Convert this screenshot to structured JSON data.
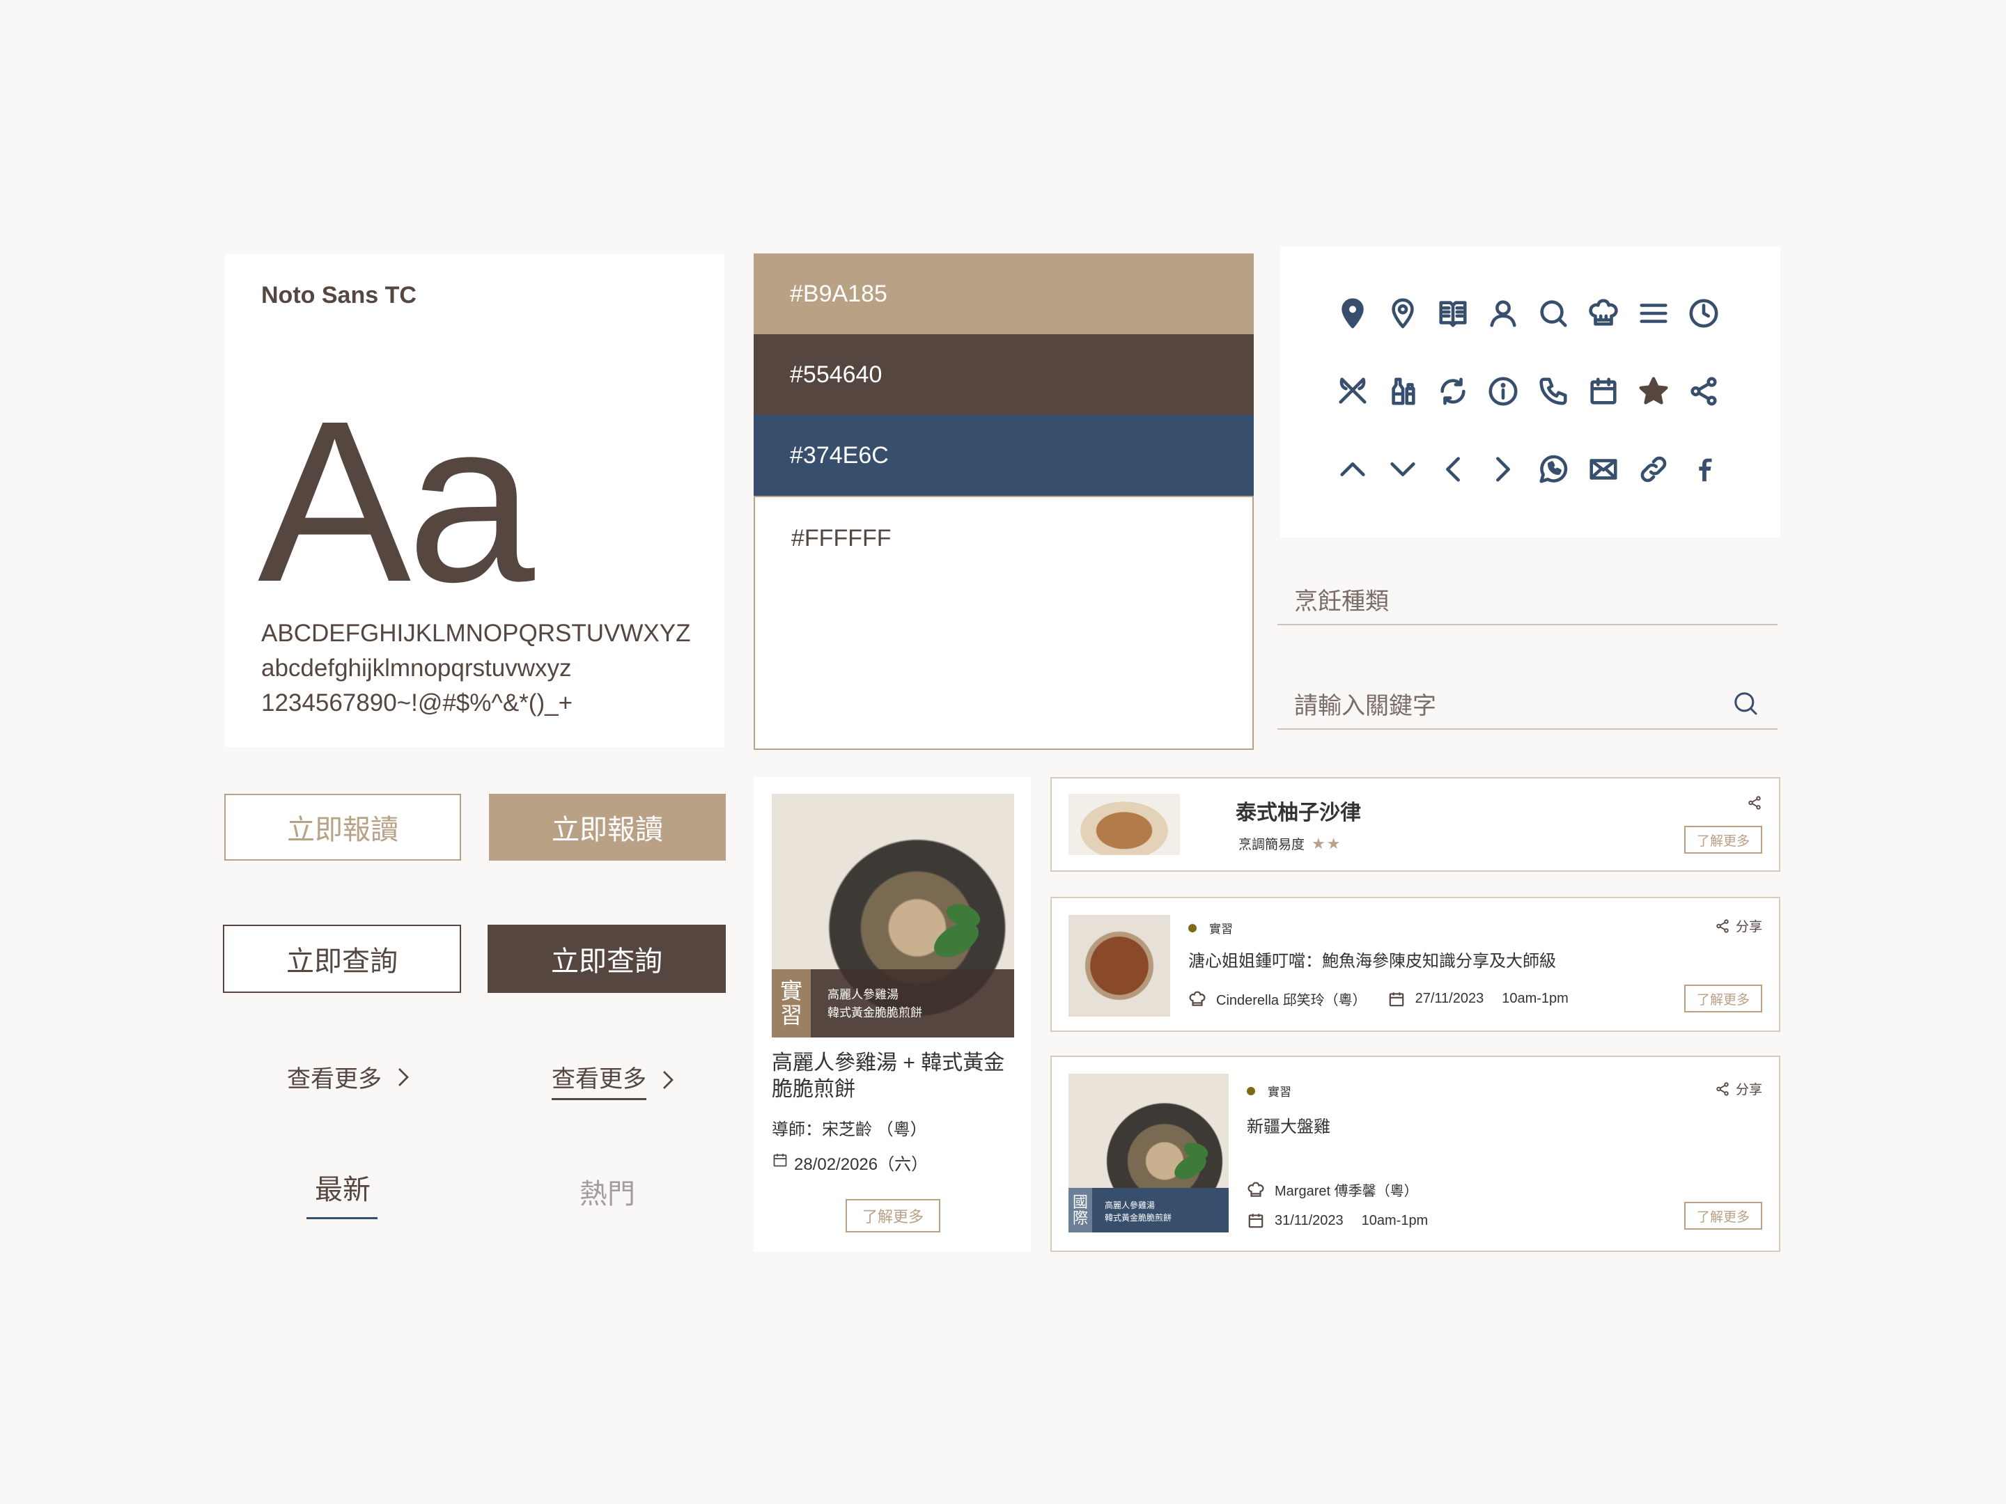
{
  "typography": {
    "font_name": "Noto Sans TC",
    "sample": "Aa",
    "upper": "ABCDEFGHIJKLMNOPQRSTUVWXYZ",
    "lower": "abcdefghijklmnopqrstuvwxyz",
    "digits": "1234567890~!@#$%^&*()_+"
  },
  "colors": {
    "swatches": [
      "#B9A185",
      "#554640",
      "#374E6C",
      "#FFFFFF"
    ]
  },
  "icons": [
    "location-filled-icon",
    "location-outline-icon",
    "book-icon",
    "user-icon",
    "search-icon",
    "chef-hat-icon",
    "menu-icon",
    "clock-icon",
    "utensils-icon",
    "condiments-icon",
    "refresh-icon",
    "info-icon",
    "phone-icon",
    "calendar-icon",
    "star-icon",
    "share-icon",
    "chevron-up-icon",
    "chevron-down-icon",
    "chevron-left-icon",
    "chevron-right-icon",
    "whatsapp-icon",
    "mail-icon",
    "link-icon",
    "facebook-icon"
  ],
  "inputs": {
    "category": "烹飪種類",
    "search_placeholder": "請輸入關鍵字"
  },
  "buttons": {
    "enroll": "立即報讀",
    "query": "立即查詢",
    "more": "查看更多"
  },
  "tabs": {
    "latest": "最新",
    "hot": "熱門"
  },
  "course_card": {
    "tag": [
      "實",
      "習"
    ],
    "overlay_line1": "高麗人參雞湯",
    "overlay_line2": "韓式黃金脆脆煎餅",
    "title": "高麗人參雞湯 + 韓式黃金脆脆煎餅",
    "mentor": "導師：宋芝齡 （粵）",
    "date": "28/02/2026（六）",
    "more": "了解更多"
  },
  "recipe_card": {
    "title": "泰式柚子沙律",
    "difficulty_label": "烹調簡易度",
    "difficulty": 2,
    "stars": "★★",
    "more": "了解更多"
  },
  "event_cards": [
    {
      "tag": "實習",
      "title": "溏心姐姐鍾叮噹：鮑魚海參陳皮知識分享及大師級",
      "mentor": "Cinderella 邱笑玲（粵）",
      "date": "27/11/2023",
      "time": "10am-1pm",
      "share": "分享",
      "more": "了解更多"
    },
    {
      "tag": "實習",
      "title": "新疆大盤雞",
      "mentor": "Margaret 傅季馨（粵）",
      "date": "31/11/2023",
      "time": "10am-1pm",
      "share": "分享",
      "more": "了解更多",
      "image_tag": [
        "國",
        "際"
      ],
      "image_line1": "高麗人參雞湯",
      "image_line2": "韓式黃金脆脆煎餅"
    }
  ]
}
